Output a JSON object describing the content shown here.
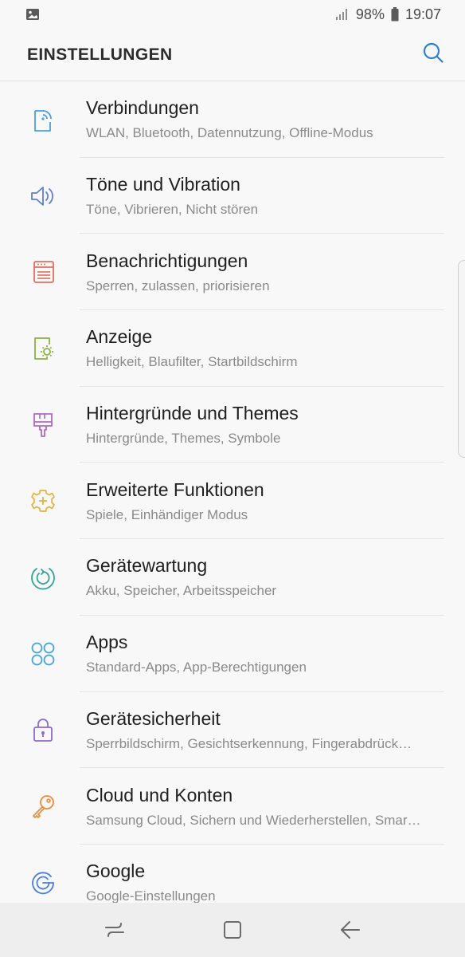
{
  "status_bar": {
    "battery": "98%",
    "time": "19:07",
    "left_icon": "gallery-icon",
    "signal_icon": "signal-icon",
    "battery_icon": "battery-icon"
  },
  "header": {
    "title": "EINSTELLUNGEN",
    "search_icon": "search-icon",
    "accent": "#2f7fd6"
  },
  "settings": [
    {
      "title": "Verbindungen",
      "subtitle": "WLAN, Bluetooth, Datennutzung, Offline-Modus",
      "icon": "connections-icon",
      "color": "#4a9ee2"
    },
    {
      "title": "Töne und Vibration",
      "subtitle": "Töne, Vibrieren, Nicht stören",
      "icon": "sound-icon",
      "color": "#5c80d6"
    },
    {
      "title": "Benachrichtigungen",
      "subtitle": "Sperren, zulassen, priorisieren",
      "icon": "notifications-icon",
      "color": "#e06f5e"
    },
    {
      "title": "Anzeige",
      "subtitle": "Helligkeit, Blaufilter, Startbildschirm",
      "icon": "display-icon",
      "color": "#8ab244"
    },
    {
      "title": "Hintergründe und Themes",
      "subtitle": "Hintergründe, Themes, Symbole",
      "icon": "wallpaper-themes-icon",
      "color": "#b16ac2"
    },
    {
      "title": "Erweiterte Funktionen",
      "subtitle": "Spiele, Einhändiger Modus",
      "icon": "advanced-features-icon",
      "color": "#e6b23f"
    },
    {
      "title": "Gerätewartung",
      "subtitle": "Akku, Speicher, Arbeitsspeicher",
      "icon": "device-maintenance-icon",
      "color": "#2ea893"
    },
    {
      "title": "Apps",
      "subtitle": "Standard-Apps, App-Berechtigungen",
      "icon": "apps-icon",
      "color": "#4aa4de"
    },
    {
      "title": "Gerätesicherheit",
      "subtitle": "Sperrbildschirm, Gesichtserkennung, Fingerabdrück…",
      "icon": "lock-icon",
      "color": "#8a6bd1"
    },
    {
      "title": "Cloud und Konten",
      "subtitle": "Samsung Cloud, Sichern und Wiederherstellen, Smar…",
      "icon": "key-icon",
      "color": "#ef8a36"
    },
    {
      "title": "Google",
      "subtitle": "Google-Einstellungen",
      "icon": "google-icon",
      "color": "#4a7de0"
    }
  ],
  "nav_bar": {
    "recent_icon": "recent-apps-icon",
    "home_icon": "home-icon",
    "back_icon": "back-icon"
  }
}
